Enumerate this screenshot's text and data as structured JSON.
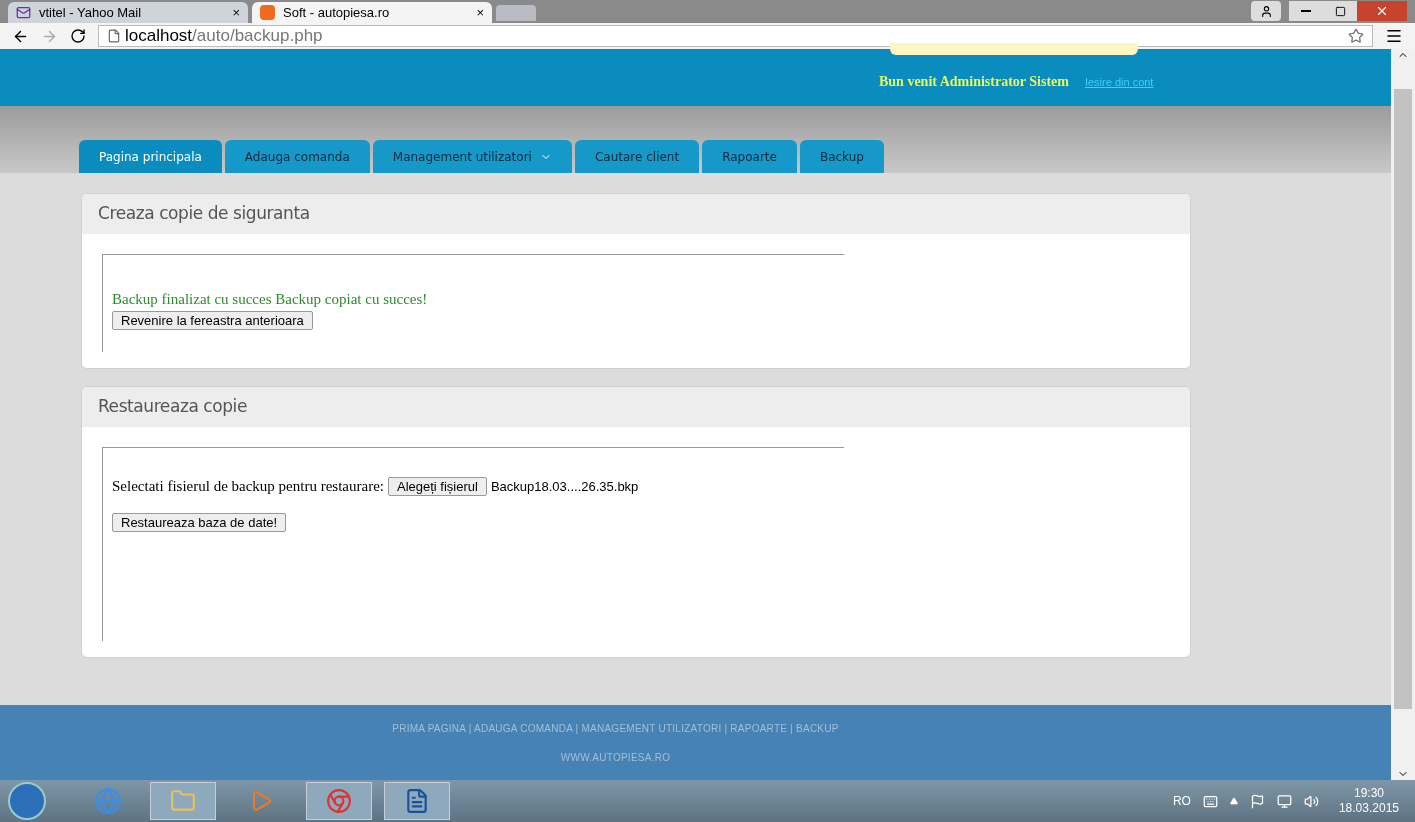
{
  "browser": {
    "tabs": [
      {
        "title": "vtitel - Yahoo Mail",
        "selected": false
      },
      {
        "title": "Soft - autopiesa.ro",
        "selected": true
      }
    ],
    "close_label": "×",
    "url_host": "localhost",
    "url_path": "/auto/backup.php"
  },
  "header": {
    "welcome": "Bun venit Administrator Sistem",
    "logout": "Iesire din cont"
  },
  "nav": [
    {
      "label": "Pagina principala",
      "selected": true,
      "dropdown": false
    },
    {
      "label": "Adauga comanda",
      "selected": false,
      "dropdown": false
    },
    {
      "label": "Management utilizatori",
      "selected": false,
      "dropdown": true
    },
    {
      "label": "Cautare client",
      "selected": false,
      "dropdown": false
    },
    {
      "label": "Rapoarte",
      "selected": false,
      "dropdown": false
    },
    {
      "label": "Backup",
      "selected": false,
      "dropdown": false
    }
  ],
  "backup_panel": {
    "title": "Creaza copie de siguranta",
    "message": "Backup finalizat cu succes Backup copiat cu succes!",
    "button": "Revenire la fereastra anterioara"
  },
  "restore_panel": {
    "title": "Restaureaza copie",
    "label": "Selectati fisierul de backup pentru restaurare:",
    "file_button": "Alegeți fișierul",
    "file_name": "Backup18.03....26.35.bkp",
    "button": "Restaureaza baza de date!"
  },
  "footer": {
    "links": "PRIMA PAGINA | ADAUGA COMANDA | MANAGEMENT UTILIZATORI | RAPOARTE | BACKUP",
    "site": "WWW.AUTOPIESA.RO"
  },
  "taskbar": {
    "language": "RO",
    "time": "19:30",
    "date": "18.03.2015"
  }
}
